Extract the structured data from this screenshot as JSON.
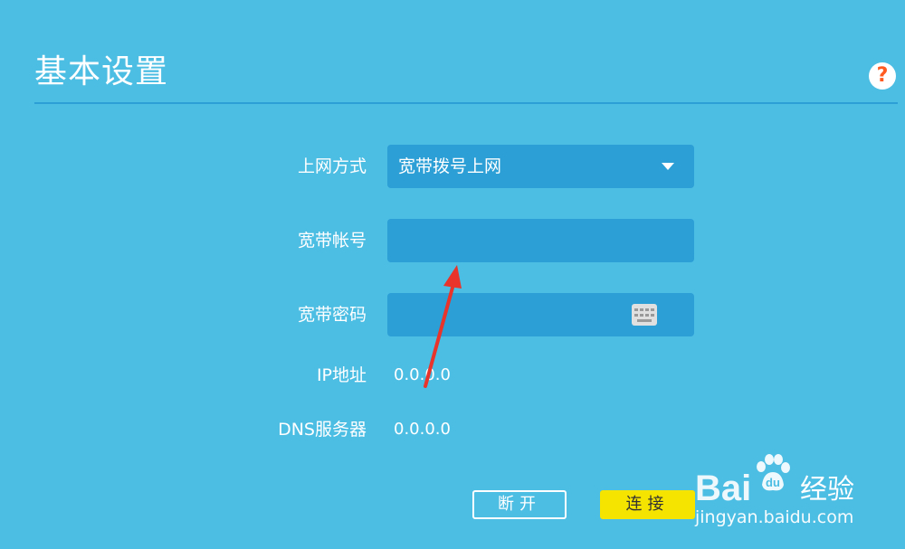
{
  "header": {
    "title": "基本设置",
    "help_symbol": "?"
  },
  "form": {
    "connection_type": {
      "label": "上网方式",
      "value": "宽带拨号上网"
    },
    "account": {
      "label": "宽带帐号",
      "value": ""
    },
    "password": {
      "label": "宽带密码",
      "value": ""
    },
    "ip": {
      "label": "IP地址",
      "value": "0.0.0.0"
    },
    "dns": {
      "label": "DNS服务器",
      "value": "0.0.0.0"
    }
  },
  "buttons": {
    "disconnect": "断开",
    "connect": "连接"
  },
  "watermark": {
    "brand": "Bai",
    "brand_suffix": "经验",
    "url": "jingyan.baidu.com"
  },
  "colors": {
    "background": "#4cbde3",
    "field": "#2b9fd6",
    "connect_button": "#f5e400",
    "help_icon_mark": "#ff5a1f",
    "annotation_arrow": "#e8342a"
  }
}
